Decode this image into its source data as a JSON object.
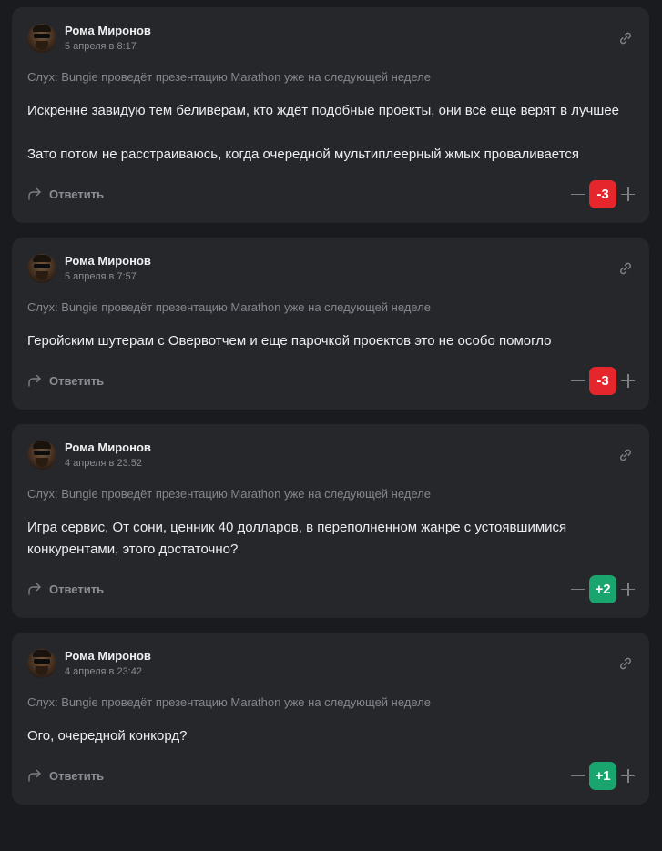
{
  "colors": {
    "background": "#1a1b1e",
    "card": "#25272b",
    "negative_score": "#e5262d",
    "positive_score": "#1aa56e"
  },
  "icons": {
    "link": "link-icon",
    "reply": "reply-arrow-icon",
    "downvote": "minus-icon",
    "upvote": "plus-icon"
  },
  "comments": [
    {
      "author": "Рома Миронов",
      "date": "5 апреля в 8:17",
      "source": "Слух: Bungie проведёт презентацию Marathon уже на следующей неделе",
      "paragraphs": [
        "Искренне завидую тем беливерам, кто ждёт подобные проекты, они всё еще верят в лучшее",
        "Зато потом не расстраиваюсь, когда очередной мультиплеерный жмых проваливается"
      ],
      "reply_label": "Ответить",
      "score": "-3",
      "score_sign": "negative"
    },
    {
      "author": "Рома Миронов",
      "date": "5 апреля в 7:57",
      "source": "Слух: Bungie проведёт презентацию Marathon уже на следующей неделе",
      "paragraphs": [
        "Геройским шутерам с Овервотчем и еще парочкой проектов это не особо помогло"
      ],
      "reply_label": "Ответить",
      "score": "-3",
      "score_sign": "negative"
    },
    {
      "author": "Рома Миронов",
      "date": "4 апреля в 23:52",
      "source": "Слух: Bungie проведёт презентацию Marathon уже на следующей неделе",
      "paragraphs": [
        "Игра сервис, От сони, ценник 40 долларов, в переполненном жанре с устоявшимися конкурентами, этого достаточно?"
      ],
      "reply_label": "Ответить",
      "score": "+2",
      "score_sign": "positive"
    },
    {
      "author": "Рома Миронов",
      "date": "4 апреля в 23:42",
      "source": "Слух: Bungie проведёт презентацию Marathon уже на следующей неделе",
      "paragraphs": [
        "Ого, очередной конкорд?"
      ],
      "reply_label": "Ответить",
      "score": "+1",
      "score_sign": "positive"
    }
  ]
}
